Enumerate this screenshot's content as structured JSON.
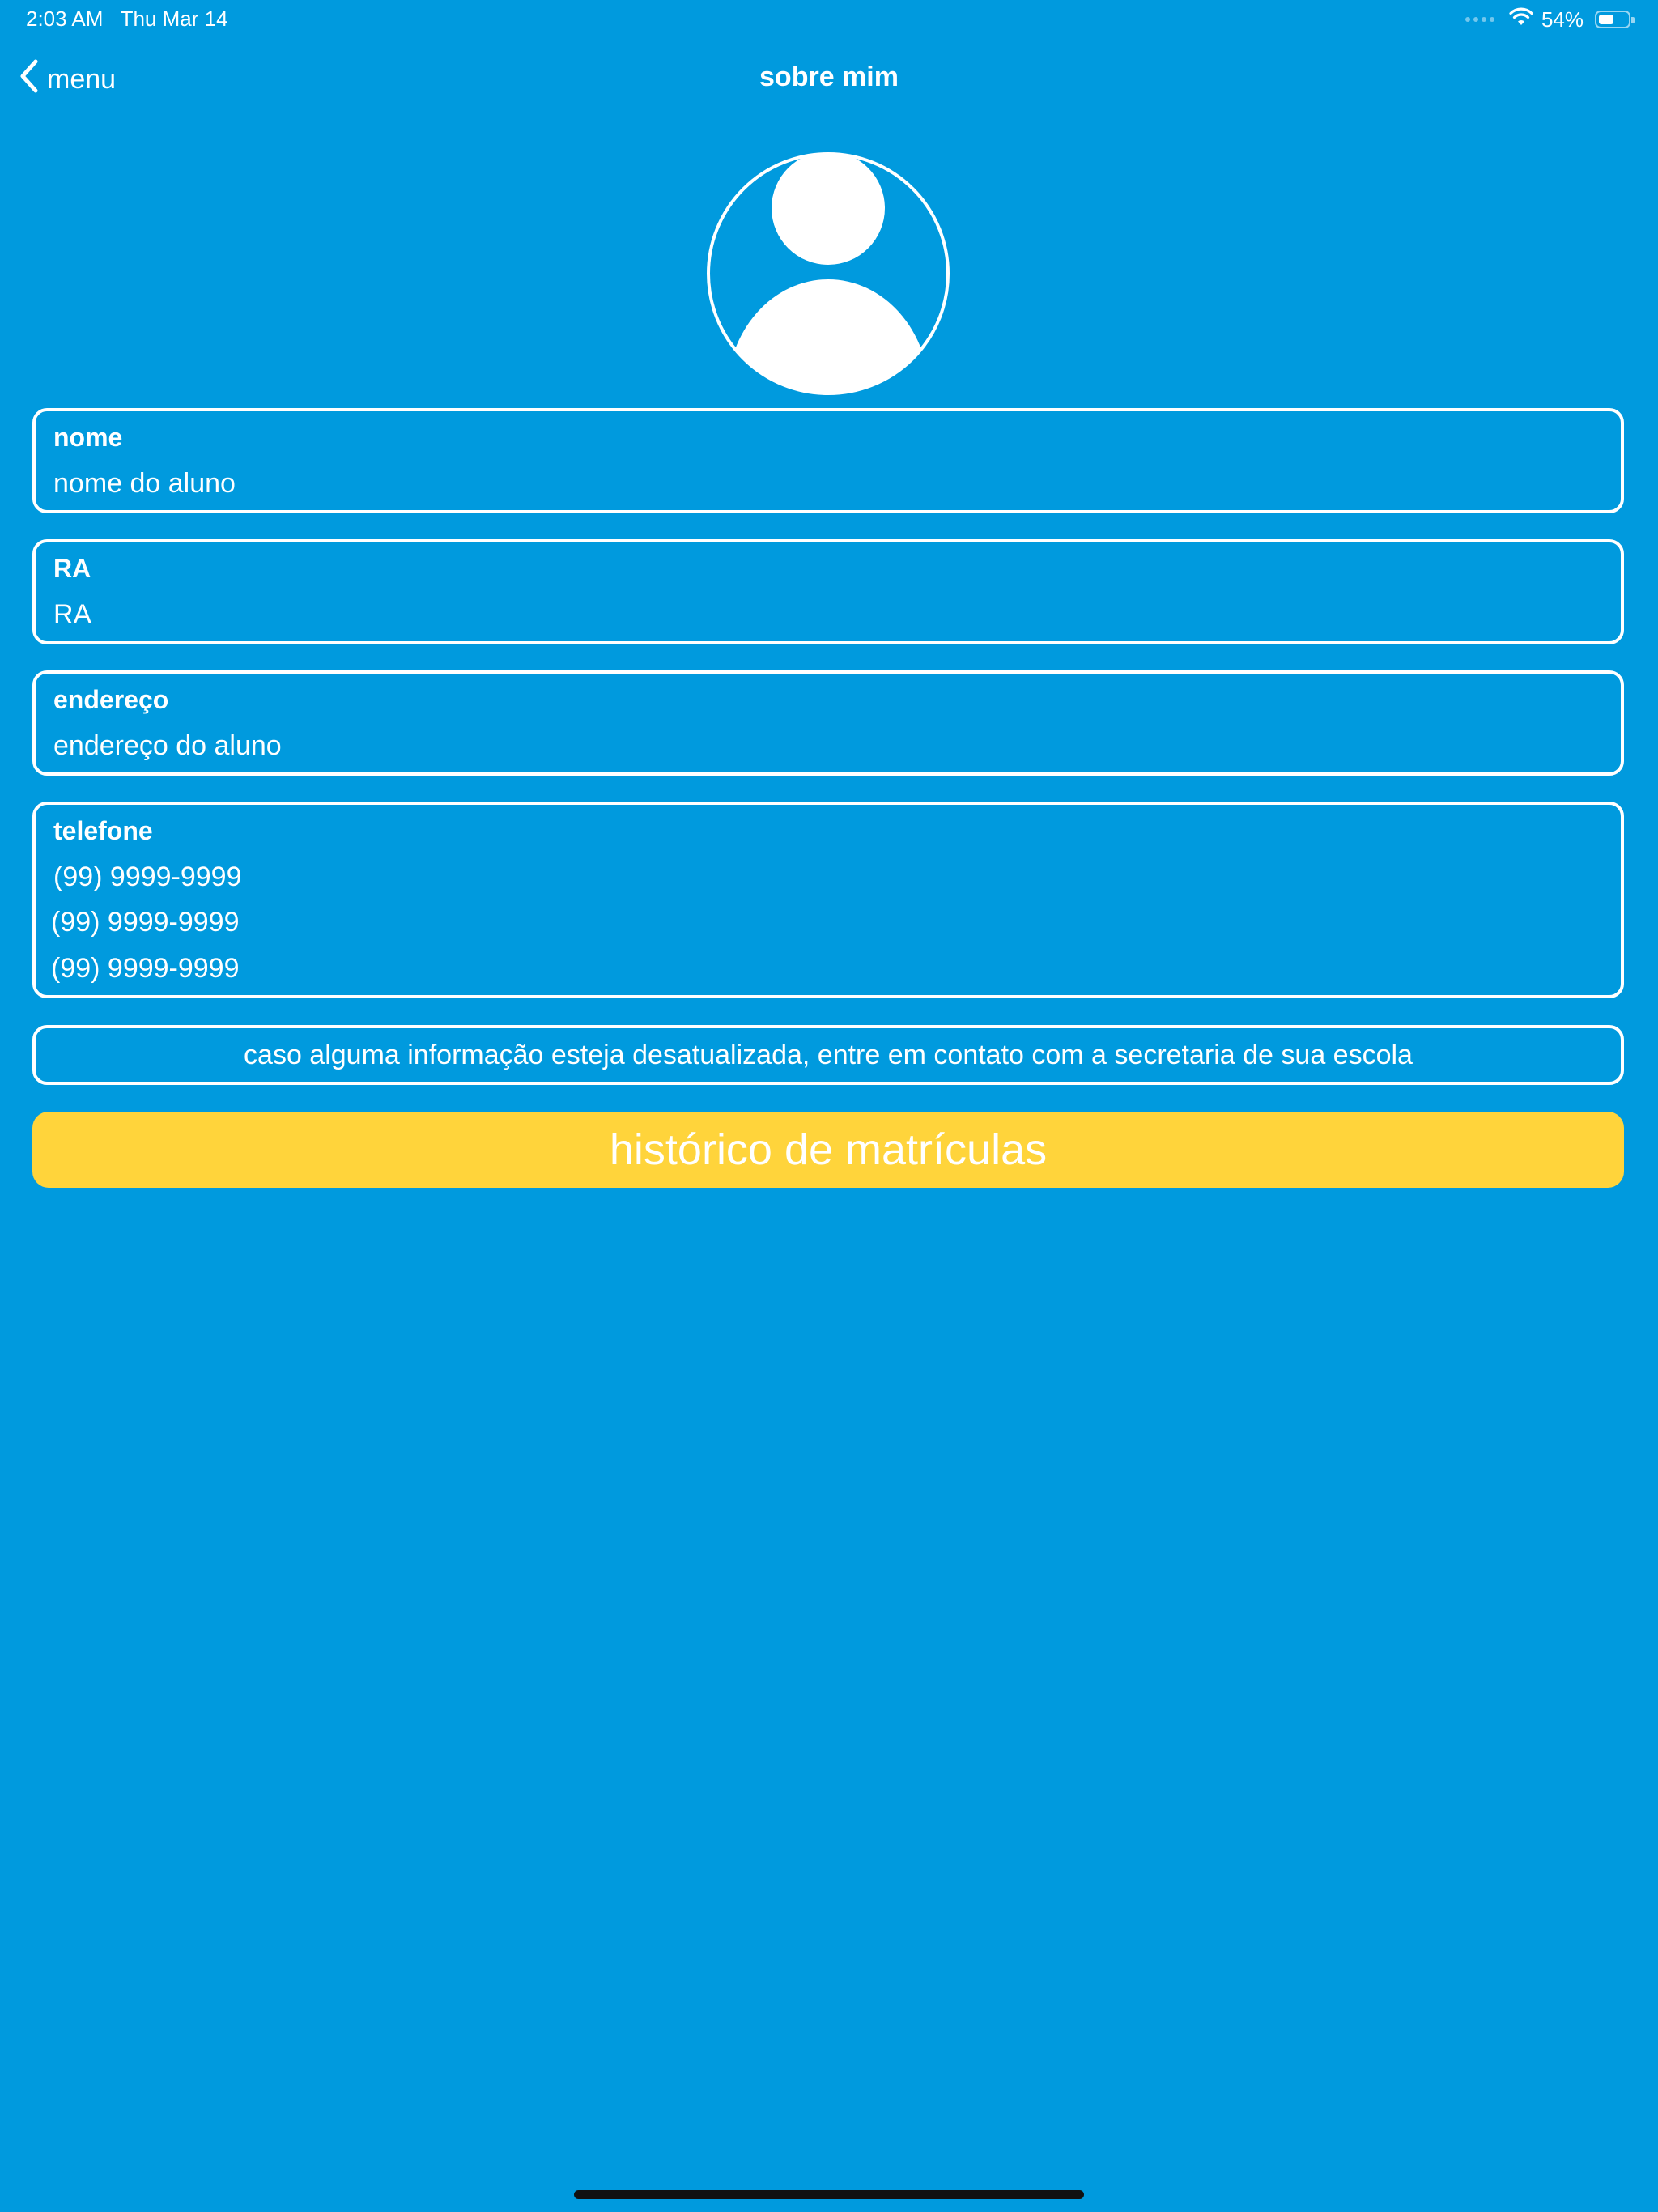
{
  "status_bar": {
    "time": "2:03 AM   Thu Mar 14",
    "battery_text": "54%",
    "battery_level": 0.54
  },
  "nav": {
    "back_label": "menu",
    "title": "sobre mim"
  },
  "fields": {
    "name": {
      "label": "nome",
      "value": "nome do aluno"
    },
    "ra": {
      "label": "RA",
      "value": "RA"
    },
    "address": {
      "label": "endereço",
      "value": "endereço do aluno"
    },
    "phone": {
      "label": "telefone",
      "values": [
        "(99) 9999-9999",
        "(99) 9999-9999",
        "(99) 9999-9999"
      ]
    }
  },
  "notice": "caso alguma informação esteja desatualizada, entre em contato com a secretaria de sua escola",
  "history_button": "histórico de matrículas",
  "colors": {
    "background": "#009ADE",
    "accent_button": "#FFD43B",
    "text": "#FFFFFF"
  },
  "icons": {
    "back": "chevron-left-icon",
    "avatar": "user-avatar-icon",
    "wifi": "wifi-icon",
    "battery": "battery-icon"
  }
}
